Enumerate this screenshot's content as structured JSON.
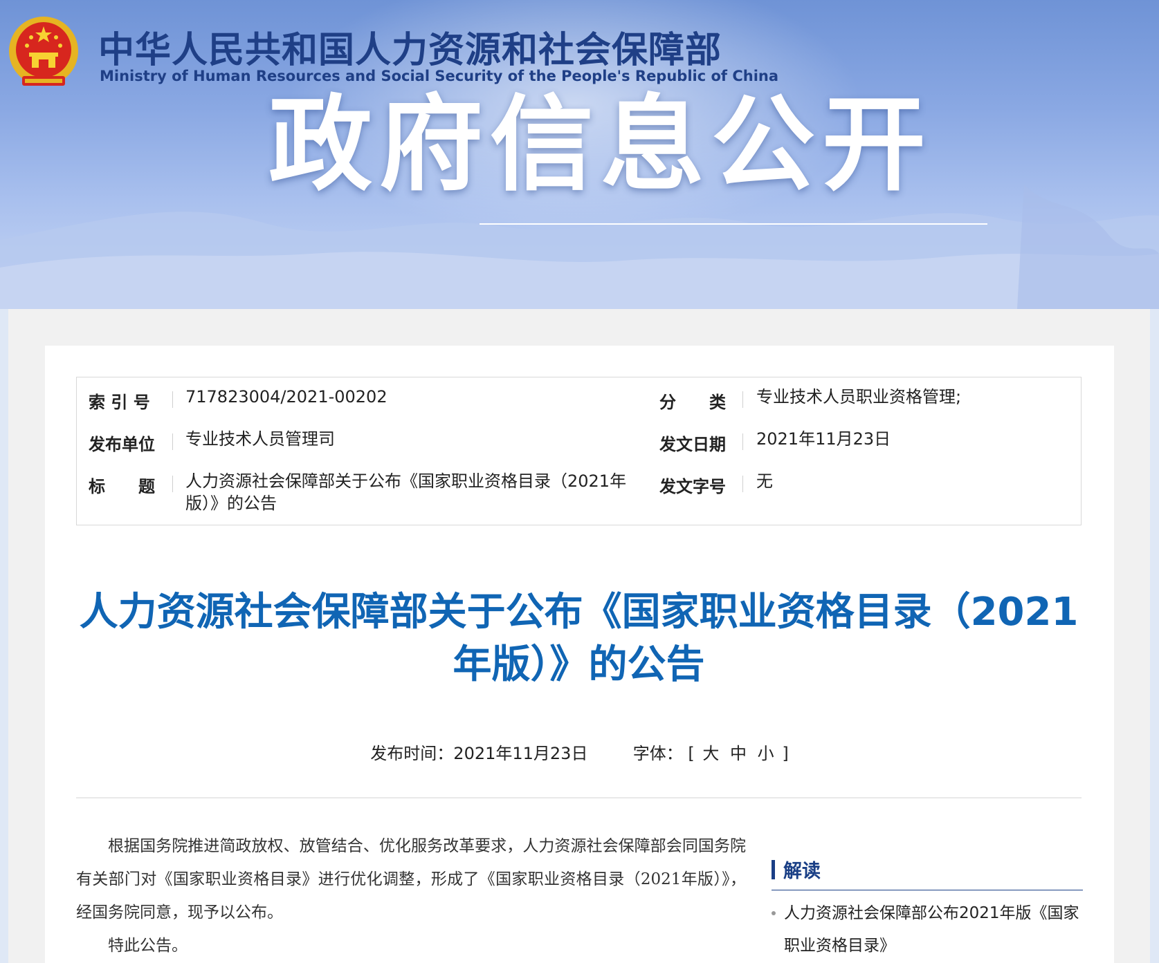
{
  "header": {
    "ministry_cn": "中华人民共和国人力资源和社会保障部",
    "ministry_en": "Ministry of Human Resources and Social Security of the People's Republic of China",
    "banner_title": "政府信息公开",
    "emblem_icon": "national-emblem-icon"
  },
  "meta": {
    "index_label": "索 引 号",
    "index_value": "717823004/2021-00202",
    "category_label": "分　　类",
    "category_value": "专业技术人员职业资格管理;",
    "issuer_label": "发布单位",
    "issuer_value": "专业技术人员管理司",
    "date_label": "发文日期",
    "date_value": "2021年11月23日",
    "title_label": "标　　题",
    "title_value": "人力资源社会保障部关于公布《国家职业资格目录（2021年版）》的公告",
    "docno_label": "发文字号",
    "docno_value": "无"
  },
  "article": {
    "title": "人力资源社会保障部关于公布《国家职业资格目录（2021年版）》的公告",
    "publish_label": "发布时间：",
    "publish_date": "2021年11月23日",
    "font_label": "字体：",
    "font_open": "[",
    "font_large": "大",
    "font_medium": "中",
    "font_small": "小",
    "font_close": "]",
    "paragraphs": [
      "根据国务院推进简政放权、放管结合、优化服务改革要求，人力资源社会保障部会同国务院有关部门对《国家职业资格目录》进行优化调整，形成了《国家职业资格目录（2021年版）》，经国务院同意，现予以公布。",
      "特此公告。"
    ]
  },
  "sidebar": {
    "title": "解读",
    "items": [
      {
        "label": "人力资源社会保障部公布2021年版《国家职业资格目录》"
      }
    ]
  },
  "colors": {
    "title_blue": "#1065b4",
    "ministry_navy": "#1f3f86",
    "sidebar_navy": "#1a3f86"
  }
}
